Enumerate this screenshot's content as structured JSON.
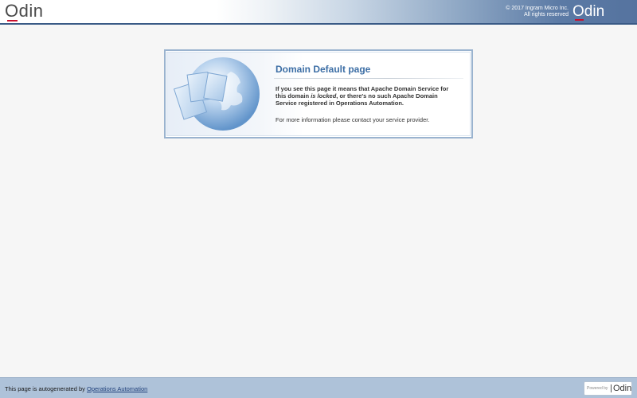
{
  "header": {
    "logo_left": "Odin",
    "copyright_line1": "© 2017 Ingram Micro Inc.",
    "copyright_line2": "All rights reserved",
    "logo_right": "Odin"
  },
  "card": {
    "title": "Domain Default page",
    "msg_part1": "If you see this page it means that Apache Domain Service for this domain",
    "msg_em": "is locked",
    "msg_part2": ", or there's no such Apache Domain Service registered in Operations Automation.",
    "info": "For more information please contact your service provider."
  },
  "footer": {
    "text": "This page is autogenerated by",
    "link": "Operations Automation",
    "powered_by": "Powered by",
    "powered_logo": "Odin"
  },
  "colors": {
    "accent": "#3c6ea5",
    "header_dark": "#3a5a86",
    "footer_bg": "#aec2d9",
    "logo_underline": "#c8102e"
  },
  "icons": {
    "card_art": "globe-with-documents-icon"
  }
}
